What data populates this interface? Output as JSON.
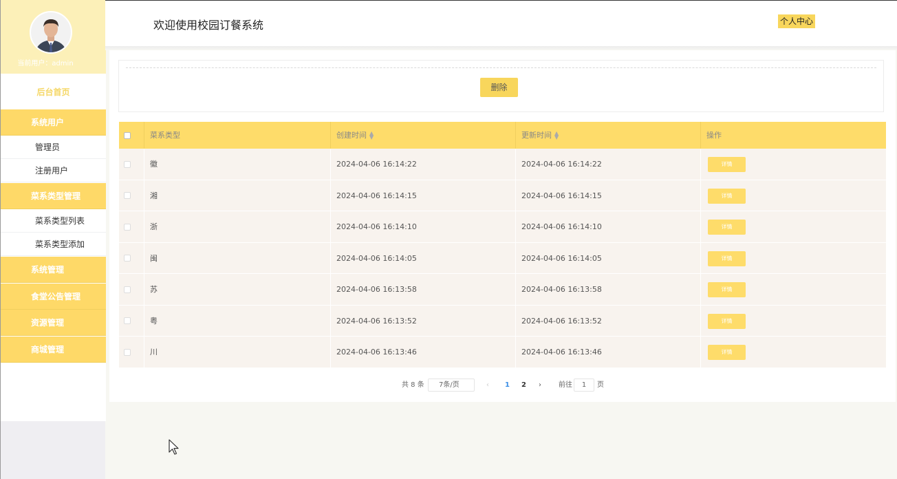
{
  "app": {
    "header_title": "欢迎使用校园订餐系统",
    "profile_link": "个人中心"
  },
  "sidebar": {
    "user_label": "当前用户：admin",
    "home": "后台首页",
    "groups": [
      {
        "label": "系统用户",
        "items": [
          "管理员",
          "注册用户"
        ]
      },
      {
        "label": "菜系类型管理",
        "items": [
          "菜系类型列表",
          "菜系类型添加"
        ]
      },
      {
        "label": "系统管理",
        "items": []
      },
      {
        "label": "食堂公告管理",
        "items": []
      },
      {
        "label": "资源管理",
        "items": []
      },
      {
        "label": "商城管理",
        "items": []
      }
    ]
  },
  "toolbar": {
    "delete_label": "删除"
  },
  "table": {
    "columns": [
      "菜系类型",
      "创建时间",
      "更新时间",
      "操作"
    ],
    "detail_label": "详情",
    "rows": [
      {
        "type": "徽",
        "created": "2024-04-06 16:14:22",
        "updated": "2024-04-06 16:14:22"
      },
      {
        "type": "湘",
        "created": "2024-04-06 16:14:15",
        "updated": "2024-04-06 16:14:15"
      },
      {
        "type": "浙",
        "created": "2024-04-06 16:14:10",
        "updated": "2024-04-06 16:14:10"
      },
      {
        "type": "闽",
        "created": "2024-04-06 16:14:05",
        "updated": "2024-04-06 16:14:05"
      },
      {
        "type": "苏",
        "created": "2024-04-06 16:13:58",
        "updated": "2024-04-06 16:13:58"
      },
      {
        "type": "粤",
        "created": "2024-04-06 16:13:52",
        "updated": "2024-04-06 16:13:52"
      },
      {
        "type": "川",
        "created": "2024-04-06 16:13:46",
        "updated": "2024-04-06 16:13:46"
      }
    ]
  },
  "pagination": {
    "total": "共 8 条",
    "page_size": "7条/页",
    "prev": "‹",
    "pages": [
      "1",
      "2"
    ],
    "next": "›",
    "goto_label": "前往",
    "goto_value": "1",
    "page_suffix": "页"
  },
  "colors": {
    "accent": "#fed968",
    "profile_bg": "#fcf0b8",
    "row_bg": "#f8f3ee",
    "active_page": "#3a8ee6"
  }
}
